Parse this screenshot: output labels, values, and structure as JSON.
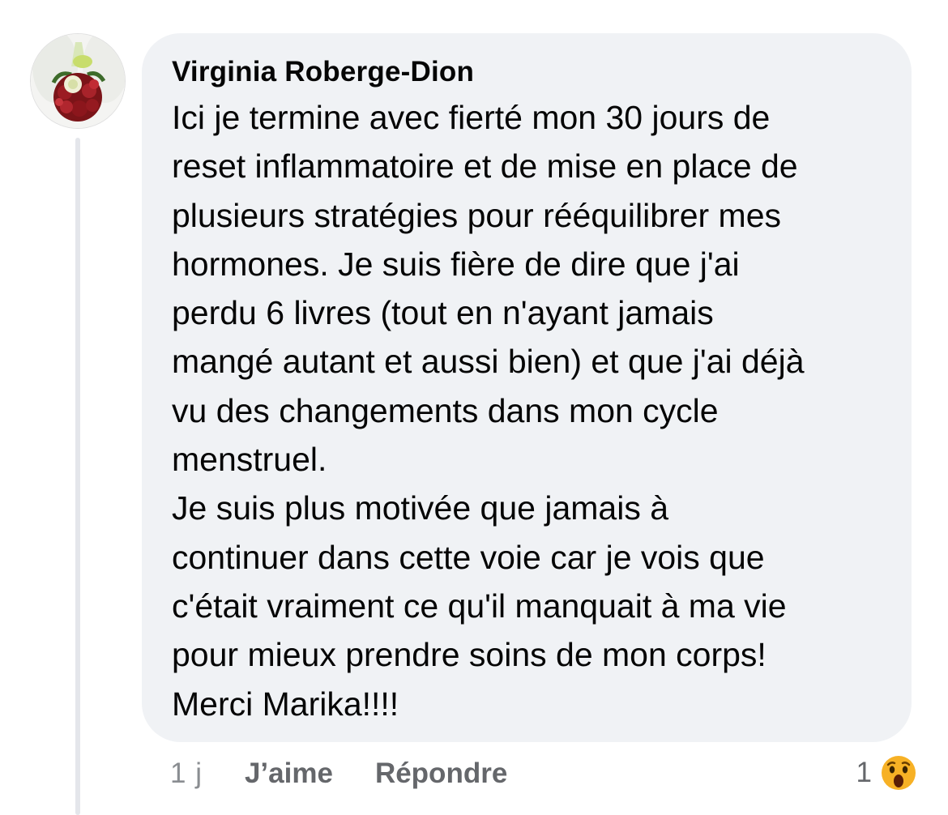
{
  "comment": {
    "author": "Virginia Roberge-Dion",
    "lines": [
      "Ici je termine avec fierté mon 30 jours de",
      "reset inflammatoire et de mise en place de",
      "plusieurs stratégies pour rééquilibrer mes",
      "hormones. Je suis fière de dire que j'ai",
      "perdu 6 livres (tout en n'ayant jamais",
      "mangé autant et aussi bien) et que j'ai déjà",
      "vu des changements dans mon cycle",
      "menstruel.",
      "Je suis plus motivée que jamais à",
      "continuer dans cette voie car je vois que",
      "c'était vraiment ce qu'il manquait à ma vie",
      "pour mieux prendre soins de mon corps!",
      "Merci Marika!!!!"
    ]
  },
  "meta": {
    "time": "1 j",
    "like_label": "J’aime",
    "reply_label": "Répondre"
  },
  "reactions": {
    "count": "1",
    "icon": "wow-reaction-icon"
  },
  "colors": {
    "bubble": "#f0f2f5",
    "meta_text": "#65676b",
    "thread_line": "#e4e6eb",
    "wow_face": "#f7b125"
  }
}
